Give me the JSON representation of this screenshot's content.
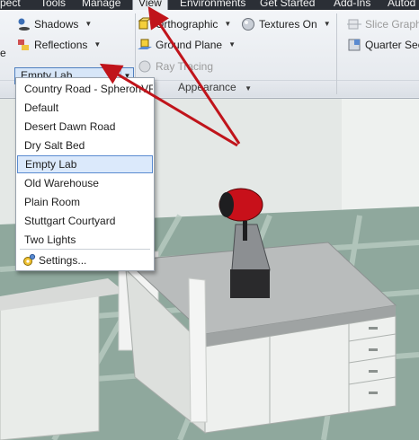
{
  "menu": {
    "tabs": [
      {
        "label": "pect"
      },
      {
        "label": "Tools"
      },
      {
        "label": "Manage"
      },
      {
        "label": "View"
      },
      {
        "label": "Environments"
      },
      {
        "label": "Get Started"
      },
      {
        "label": "Add-Ins"
      },
      {
        "label": "Autod"
      }
    ],
    "active_tab": "View"
  },
  "ribbon": {
    "shadows_label": "Shadows",
    "reflections_label": "Reflections",
    "orthographic_label": "Orthographic",
    "ground_plane_label": "Ground Plane",
    "ray_tracing_label": "Ray Tracing",
    "textures_label": "Textures On",
    "slice_graphics_label": "Slice Graph",
    "quarter_section_label": "Quarter Sec",
    "stub_label": "e",
    "panel_label": "Appearance",
    "environment_combo": {
      "value": "Empty Lab"
    }
  },
  "dropdown": {
    "items": [
      {
        "label": "Country Road - SpheronVR"
      },
      {
        "label": "Default"
      },
      {
        "label": "Desert Dawn Road"
      },
      {
        "label": "Dry Salt Bed"
      },
      {
        "label": "Empty Lab"
      },
      {
        "label": "Old Warehouse"
      },
      {
        "label": "Plain Room"
      },
      {
        "label": "Stuttgart Courtyard"
      },
      {
        "label": "Two Lights"
      }
    ],
    "selected": "Empty Lab",
    "settings_label": "Settings..."
  },
  "colors": {
    "annotation_arrow": "#c0141b",
    "selection_fill": "#dbe9fb",
    "selection_border": "#5a8bd0",
    "flashlight_red": "#c8101a"
  }
}
